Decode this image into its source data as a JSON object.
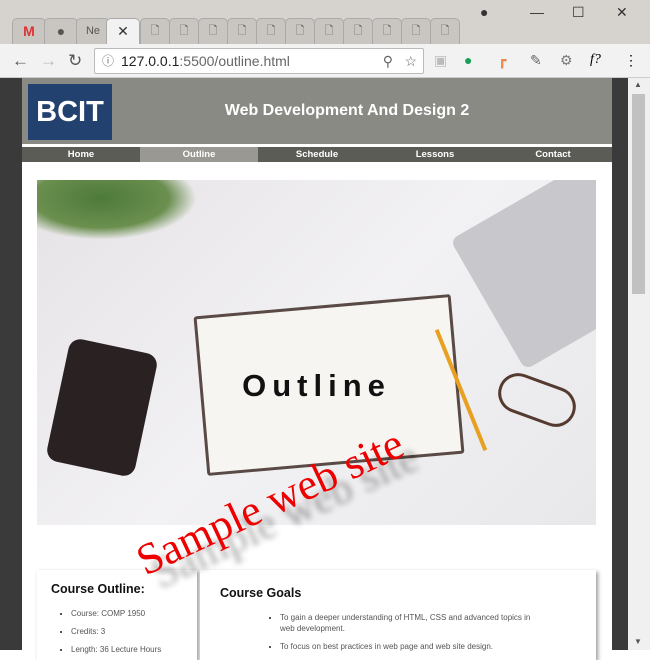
{
  "browser": {
    "tabs": [
      {
        "icon": "gmail-icon",
        "label": "M"
      },
      {
        "icon": "github-icon",
        "label": ""
      },
      {
        "icon": "page-icon",
        "label": "Ne"
      },
      {
        "icon": "close-icon",
        "label": "✕",
        "active": true
      }
    ],
    "blank_tab_count": 11,
    "url_host": "127.0.0.1",
    "url_rest": ":5500/outline.html"
  },
  "site": {
    "logo": "BCIT",
    "title": "Web Development And Design 2",
    "nav": [
      "Home",
      "Outline",
      "Schedule",
      "Lessons",
      "Contact"
    ],
    "active_nav": "Outline",
    "hero_title": "Outline"
  },
  "outline": {
    "heading": "Course Outline:",
    "items": [
      "Course: COMP 1950",
      "Credits: 3",
      "Length: 36 Lecture Hours"
    ]
  },
  "goals": {
    "heading": "Course Goals",
    "items": [
      "To gain a deeper understanding of HTML, CSS and advanced topics in web development.",
      "To focus on best practices in web page and web site design."
    ]
  },
  "watermark": "Sample web site"
}
